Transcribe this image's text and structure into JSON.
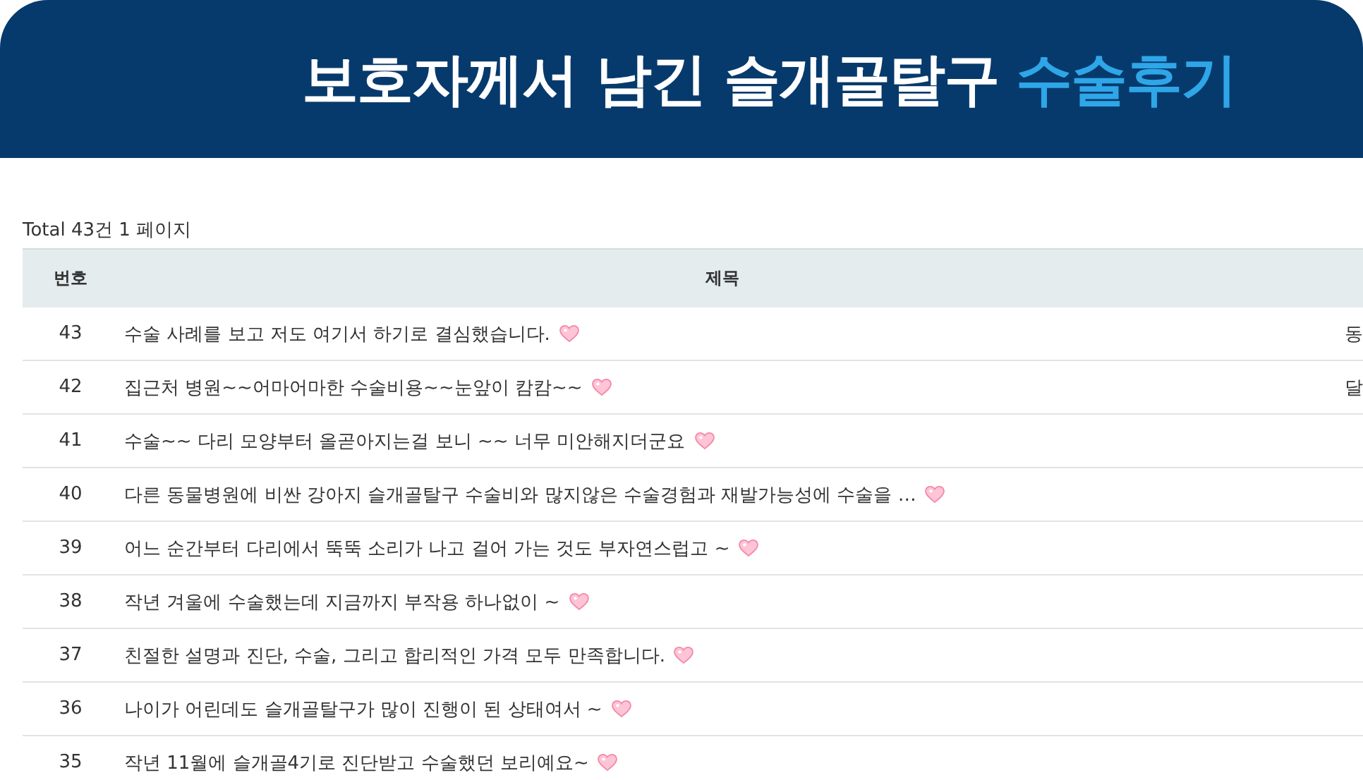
{
  "banner": {
    "title": "보호자께서 남긴 슬개골탈구",
    "title_highlight": "수술후기"
  },
  "summary": "Total 43건 1 페이지",
  "table": {
    "columns": [
      "번호",
      "제목"
    ],
    "rows": [
      {
        "number": "43",
        "title": "수술 사례를 보고 저도 여기서 하기로 결심했습니다.",
        "column_3": "동"
      },
      {
        "number": "42",
        "title": "집근처 병원~~어마어마한 수술비용~~눈앞이 캄캄~~",
        "column_3": "달"
      },
      {
        "number": "41",
        "title": "수술~~ 다리 모양부터 올곧아지는걸 보니 ~~ 너무 미안해지더군요"
      },
      {
        "number": "40",
        "title": "다른 동물병원에 비싼 강아지 슬개골탈구 수술비와 많지않은 수술경험과 재발가능성에 수술을 …"
      },
      {
        "number": "39",
        "title": "어느 순간부터 다리에서 뚝뚝 소리가 나고 걸어 가는 것도 부자연스럽고 ~"
      },
      {
        "number": "38",
        "title": "작년 겨울에 수술했는데 지금까지 부작용 하나없이 ~"
      },
      {
        "number": "37",
        "title": "친절한 설명과 진단, 수술, 그리고 합리적인 가격 모두 만족합니다."
      },
      {
        "number": "36",
        "title": "나이가 어린데도 슬개골탈구가 많이 진행이 된 상태여서 ~"
      },
      {
        "number": "35",
        "title": "작년 11월에 슬개골4기로 진단받고 수술했던 보리예요~"
      }
    ]
  }
}
